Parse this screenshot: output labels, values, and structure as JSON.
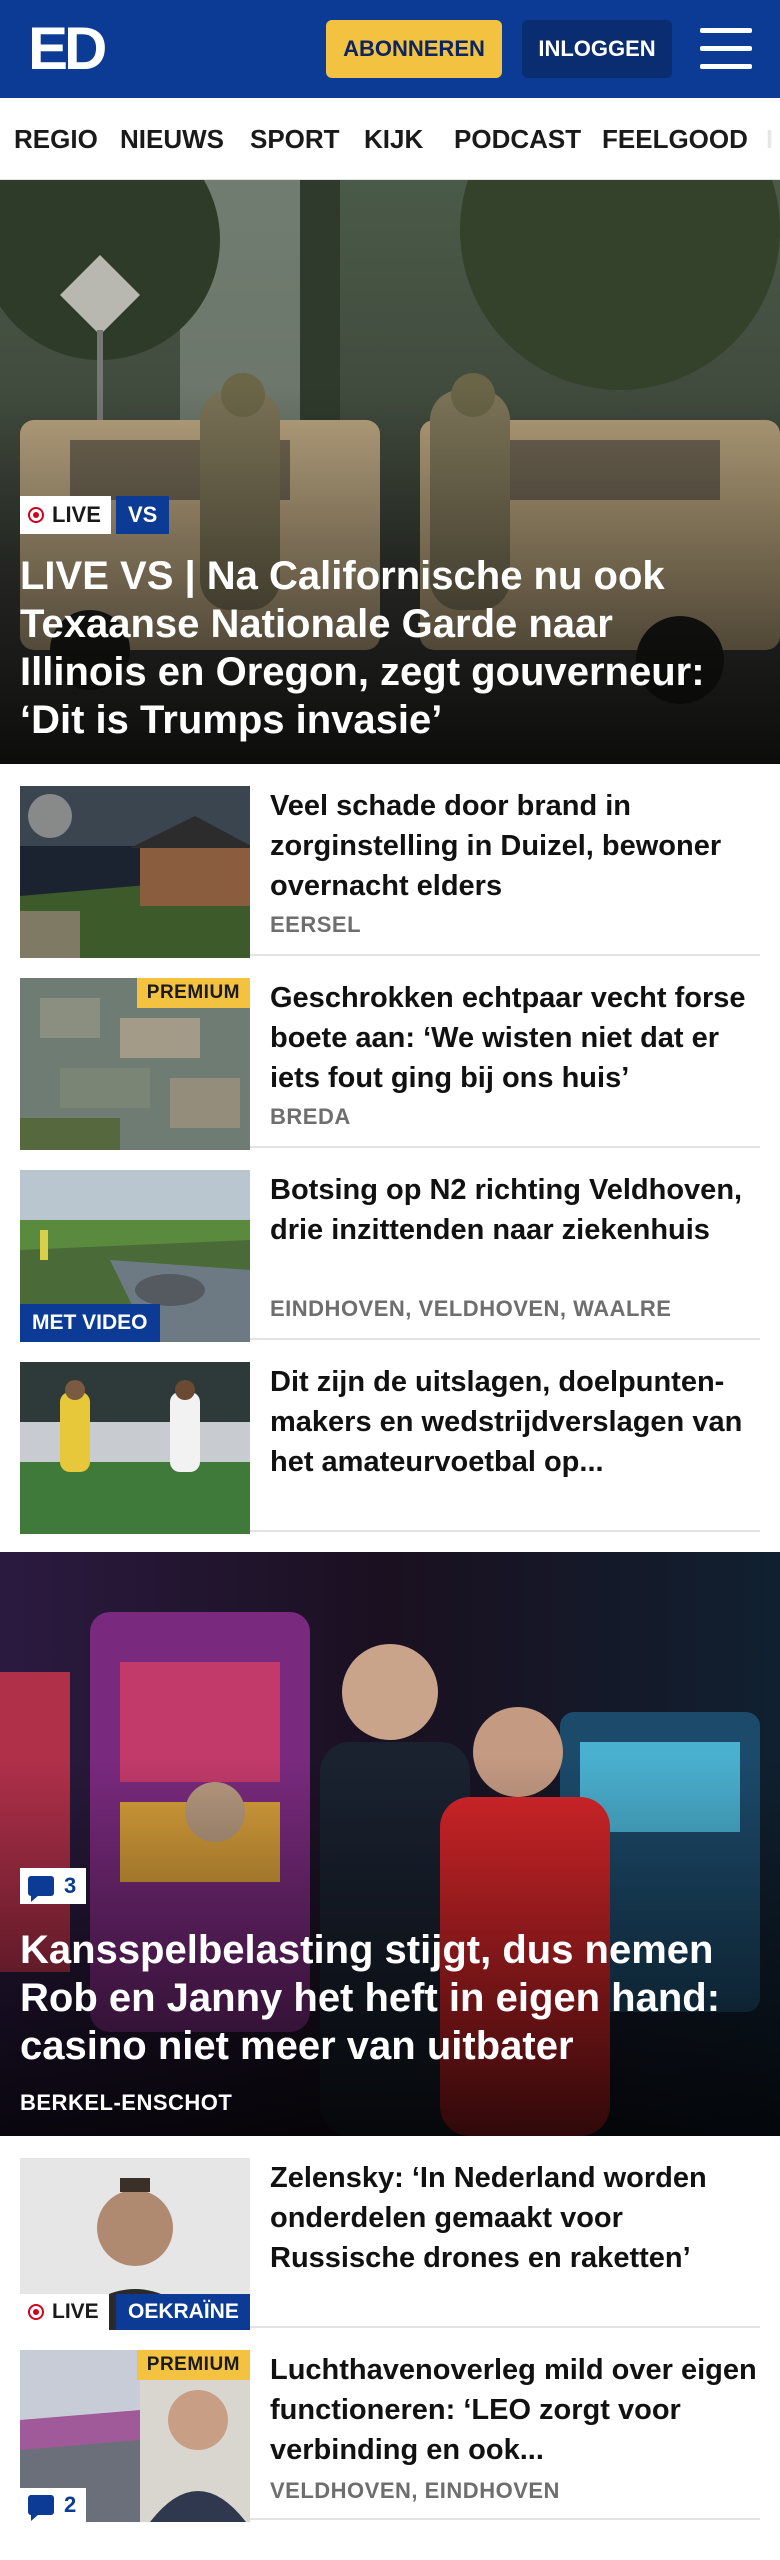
{
  "header": {
    "logo": "ED",
    "subscribe_label": "ABONNEREN",
    "login_label": "INLOGGEN",
    "colors": {
      "brand": "#0b3b95",
      "accent": "#f3c240"
    }
  },
  "nav": {
    "items": [
      "REGIO",
      "NIEUWS",
      "SPORT",
      "KIJK",
      "PODCAST",
      "FEELGOOD",
      "I"
    ]
  },
  "hero": {
    "live_label": "LIVE",
    "topic": "VS",
    "title": "LIVE VS | Na Californische nu ook Texaanse Nationale Garde naar Illinois en Oregon, zegt gouverneur: ‘Dit is Trumps invasie’"
  },
  "articles": [
    {
      "title": "Veel schade door brand in zorginstelling in Duizel, bewoner overnacht elders",
      "location": "EERSEL"
    },
    {
      "title": "Geschrokken echtpaar vecht forse boete aan: ‘We wisten niet dat er iets fout ging bij ons huis’",
      "location": "BREDA",
      "badge": "PREMIUM"
    },
    {
      "title": "Botsing op N2 richting Veldhoven, drie inzittenden naar ziekenhuis",
      "location": "EINDHOVEN, VELDHOVEN, WAALRE",
      "badge": "MET VIDEO"
    },
    {
      "title": "Dit zijn de uitslagen, doelpunten-makers en wedstrijdverslagen van het amateurvoetbal op..."
    }
  ],
  "feature": {
    "comments": "3",
    "title": "Kansspelbelasting stijgt, dus nemen Rob en Janny het heft in eigen hand: casino niet meer van uitbater",
    "location": "BERKEL-ENSCHOT"
  },
  "articles2": [
    {
      "title": "Zelensky: ‘In Nederland worden onderdelen gemaakt voor Russische drones en raketten’",
      "live_label": "LIVE",
      "topic": "OEKRAÏNE"
    },
    {
      "title": "Luchthavenoverleg mild over eigen functioneren: ‘LEO zorgt voor verbinding en ook...",
      "location": "VELDHOVEN, EINDHOVEN",
      "badge": "PREMIUM",
      "comments": "2"
    }
  ]
}
